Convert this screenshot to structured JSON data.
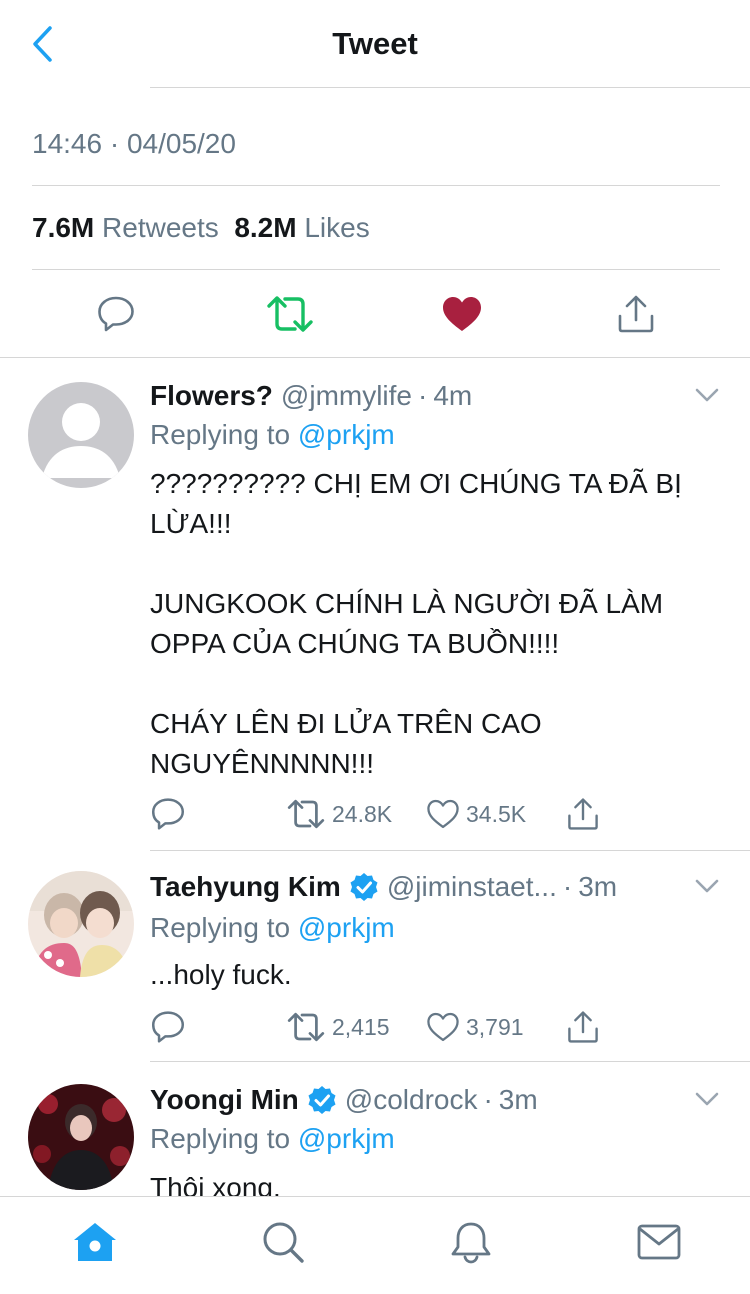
{
  "header": {
    "title": "Tweet"
  },
  "tweet": {
    "timestamp": "14:46 · 04/05/20",
    "retweets_count": "7.6M",
    "retweets_label": "Retweets",
    "likes_count": "8.2M",
    "likes_label": "Likes"
  },
  "replies": [
    {
      "name": "Flowers?",
      "handle": "@jmmylife",
      "time": "4m",
      "replying_prefix": "Replying to",
      "replying_to": "@prkjm",
      "text": "?????????? CHỊ EM ƠI CHÚNG TA ĐÃ BỊ LỪA!!!\n\nJUNGKOOK CHÍNH LÀ NGƯỜI ĐÃ LÀM OPPA CỦA CHÚNG TA BUỒN!!!!\n\nCHÁY LÊN ĐI LỬA TRÊN CAO NGUYÊNNNNN!!!",
      "retweets": "24.8K",
      "likes": "34.5K"
    },
    {
      "name": "Taehyung Kim",
      "handle": "@jiminstaet...",
      "time": "3m",
      "replying_prefix": "Replying to",
      "replying_to": "@prkjm",
      "text": "...holy fuck.",
      "retweets": "2,415",
      "likes": "3,791"
    },
    {
      "name": "Yoongi Min",
      "handle": "@coldrock",
      "time": "3m",
      "replying_prefix": "Replying to",
      "replying_to": "@prkjm",
      "text": "Thôi xong."
    }
  ],
  "colors": {
    "accent": "#1da1f2",
    "retweet_green": "#17bf63",
    "like_red": "#a8203f",
    "secondary_text": "#657786",
    "divider": "#d6d6d6"
  },
  "icons": {
    "back": "chevron-left-icon",
    "reply": "speech-bubble-icon",
    "retweet": "retweet-icon",
    "like": "heart-icon",
    "share": "share-icon",
    "home": "home-icon",
    "search": "search-icon",
    "notifications": "bell-icon",
    "messages": "envelope-icon"
  }
}
